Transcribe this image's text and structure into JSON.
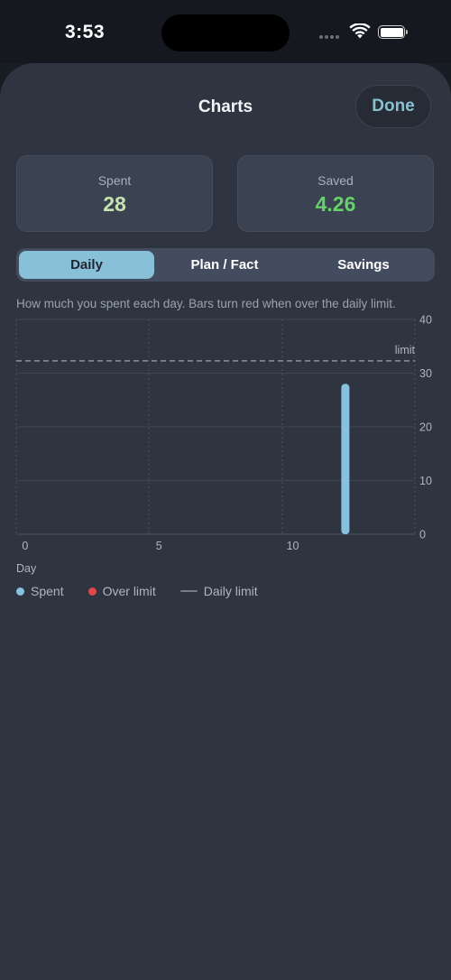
{
  "status_bar": {
    "time": "3:53"
  },
  "header": {
    "title": "Charts",
    "done_label": "Done"
  },
  "summary": {
    "spent_label": "Spent",
    "spent_value": "28",
    "saved_label": "Saved",
    "saved_value": "4.26"
  },
  "tabs": [
    {
      "label": "Daily",
      "selected": true
    },
    {
      "label": "Plan / Fact",
      "selected": false
    },
    {
      "label": "Savings",
      "selected": false
    }
  ],
  "description": "How much you spent each day. Bars turn red when over the daily limit.",
  "colors": {
    "accent": "#88c0d0",
    "spent": "#88c0e0",
    "over_limit": "#e04848",
    "daily_limit": "#767d89",
    "saved_value": "#66d06a"
  },
  "chart_data": {
    "type": "bar",
    "xlabel": "Day",
    "ylabel": "",
    "x_ticks": [
      0,
      5,
      10
    ],
    "y_ticks": [
      0,
      10,
      20,
      30,
      40
    ],
    "xlim": [
      -0.3,
      14.6
    ],
    "ylim": [
      0,
      40
    ],
    "grid": true,
    "series": [
      {
        "name": "Spent",
        "x": [
          12
        ],
        "values": [
          28
        ],
        "color": "#88c0e0"
      }
    ],
    "limit": {
      "value": 32.3,
      "label": "limit"
    },
    "legend": [
      "Spent",
      "Over limit",
      "Daily limit"
    ],
    "legend_position": "bottom-left"
  }
}
